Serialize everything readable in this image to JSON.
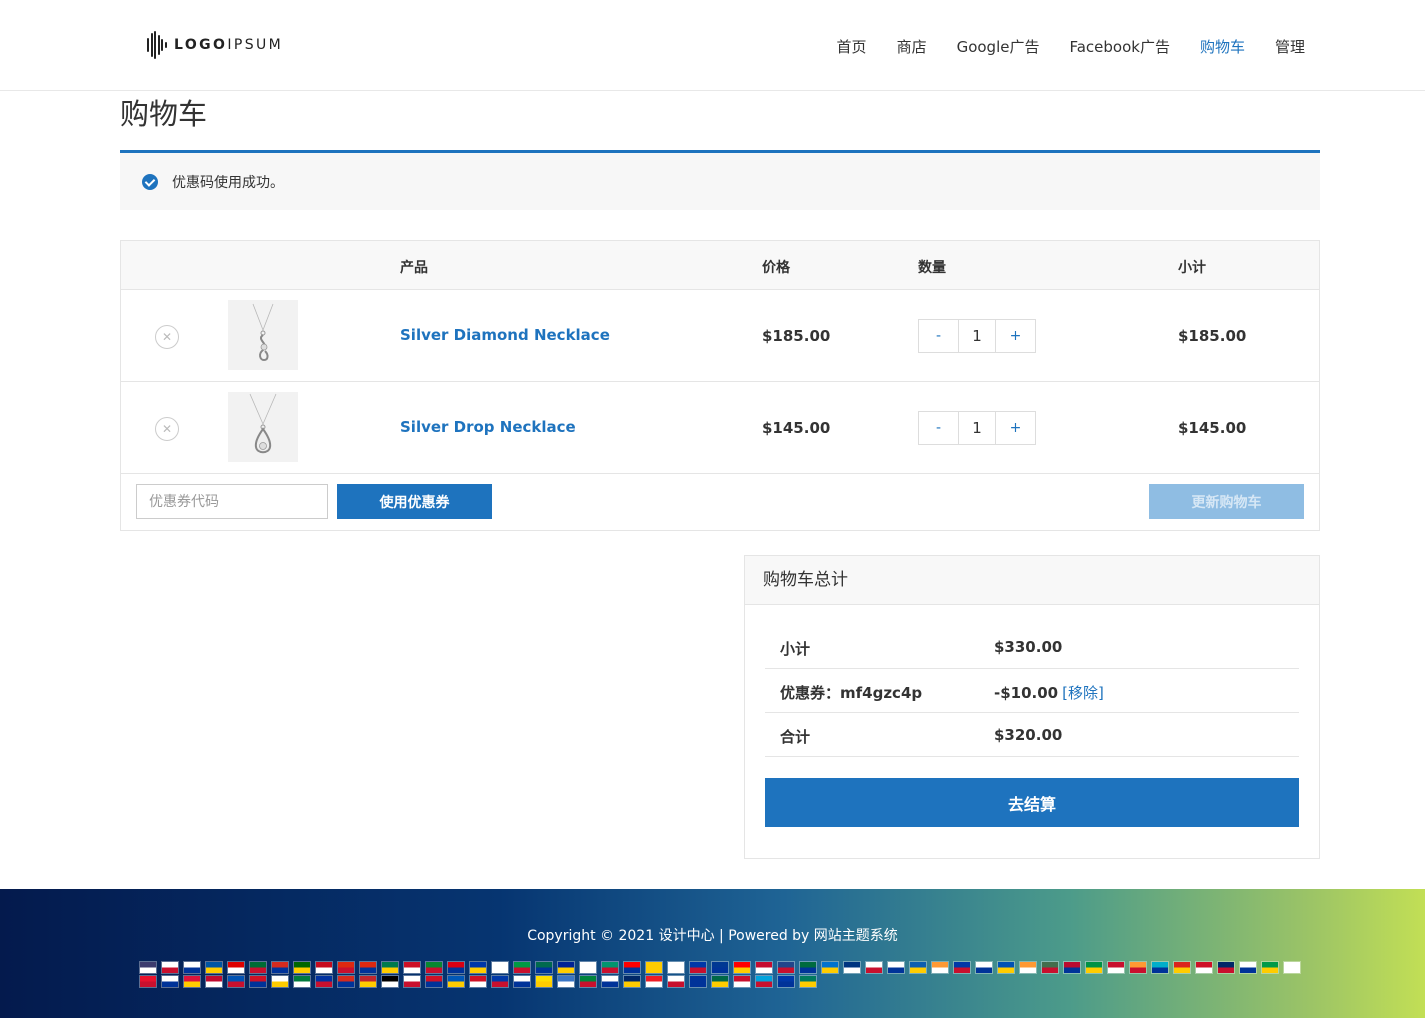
{
  "header": {
    "logo": {
      "bold": "LOGO",
      "light": "IPSUM"
    },
    "nav": [
      {
        "label": "首页"
      },
      {
        "label": "商店"
      },
      {
        "label": "Google广告"
      },
      {
        "label": "Facebook广告"
      },
      {
        "label": "购物车",
        "active": true
      },
      {
        "label": "管理"
      }
    ]
  },
  "page": {
    "title": "购物车"
  },
  "notice": {
    "text": "优惠码使用成功。"
  },
  "cart": {
    "headers": {
      "product": "产品",
      "price": "价格",
      "quantity": "数量",
      "subtotal": "小计"
    },
    "items": [
      {
        "name": "Silver Diamond Necklace",
        "price": "$185.00",
        "quantity": "1",
        "subtotal": "$185.00"
      },
      {
        "name": "Silver Drop Necklace",
        "price": "$145.00",
        "quantity": "1",
        "subtotal": "$145.00"
      }
    ],
    "qty_minus": "-",
    "qty_plus": "+",
    "remove_symbol": "✕",
    "coupon_placeholder": "优惠券代码",
    "apply_label": "使用优惠券",
    "update_label": "更新购物车"
  },
  "totals": {
    "title": "购物车总计",
    "subtotal_label": "小计",
    "subtotal_value": "$330.00",
    "coupon_label": "优惠券：mf4gzc4p",
    "coupon_value": "-$10.00",
    "coupon_remove": "[移除]",
    "total_label": "合计",
    "total_value": "$320.00",
    "checkout_label": "去结算"
  },
  "footer": {
    "copyright_prefix": "Copyright © 2021 ",
    "site_link": "设计中心",
    "powered_mid": " | Powered by ",
    "theme_link": "网站主题系统"
  },
  "colors": {
    "accent": "#1e73be",
    "update_disabled": "#8fbde3"
  },
  "flags": [
    "#3c3b6e",
    "#ffffff",
    "#ffffff",
    "#0055a4",
    "#dd0000",
    "#006c35",
    "#d52b1e",
    "#006600",
    "#c60b1e",
    "#de2910",
    "#de2910",
    "#007a4d",
    "#ce1126",
    "#078930",
    "#d90012",
    "#0038a8",
    "#ffffff",
    "#009a44",
    "#006a4e",
    "#002395",
    "#ffffff",
    "#00966e",
    "#fe0000",
    "#ffcc00",
    "#ffffff",
    "#0038a8",
    "#003893",
    "#ff0000",
    "#c60c30",
    "#21468b",
    "#006b3f",
    "#0072ce",
    "#003580",
    "#ffffff",
    "#ffffff",
    "#0d5eaf",
    "#ff9933",
    "#0038a8",
    "#ffffff",
    "#0052b4",
    "#ff9933",
    "#436f4d",
    "#ba0c2f",
    "#009246",
    "#c8102e",
    "#ff9933",
    "#00afca",
    "#da251d",
    "#ce1126",
    "#002868",
    "#ffffff",
    "#009a49",
    "#ffffff",
    "#e8112d",
    "#ffffff",
    "#dc143c",
    "#bf0a30",
    "#0052b4",
    "#ce1126",
    "#ffffff",
    "#007a3d",
    "#0032a0",
    "#d52b1e",
    "#c1272d",
    "#000000",
    "#ffffff",
    "#ce1126",
    "#0057b7",
    "#ce1126",
    "#0038a8",
    "#ffffff",
    "#fedd00",
    "#3a75c4",
    "#00843d",
    "#ffffff",
    "#002868",
    "#ee1c25",
    "#ffffff",
    "#003399",
    "#006847",
    "#c8102e",
    "#00a3dd",
    "#0038a8",
    "#007a5e"
  ]
}
